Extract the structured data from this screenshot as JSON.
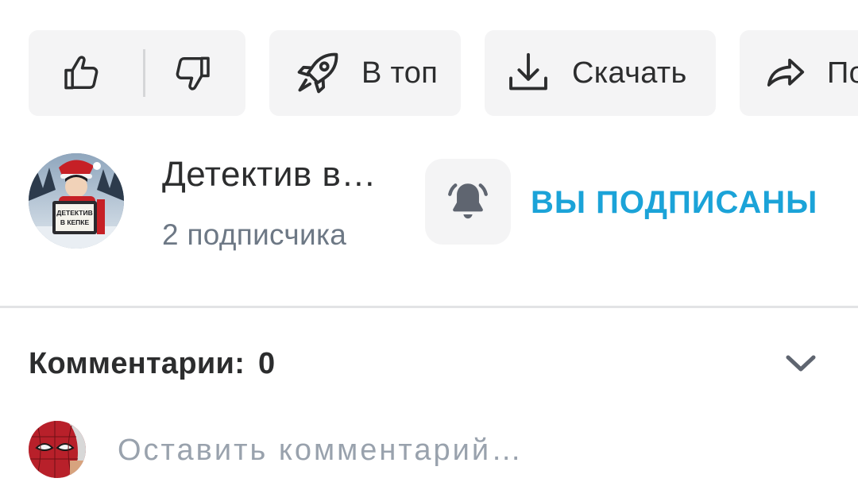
{
  "actions": {
    "top_label": "В топ",
    "download_label": "Скачать",
    "share_label": "По"
  },
  "channel": {
    "name": "Детектив в…",
    "subscribers": "2 подписчика",
    "subscribe_status": "ВЫ ПОДПИСАНЫ",
    "avatar_text_line1": "ДЕТЕКТИВ",
    "avatar_text_line2": "В КЕПКЕ"
  },
  "comments": {
    "title": "Комментарии:",
    "count": "0",
    "input_placeholder": "Оставить комментарий…"
  },
  "icons": {
    "like": "thumbs-up-icon",
    "dislike": "thumbs-down-icon",
    "top": "rocket-icon",
    "download": "download-icon",
    "share": "share-arrow-icon",
    "bell": "bell-ringing-icon",
    "chevron": "chevron-down-icon"
  },
  "colors": {
    "accent": "#1ba3d8",
    "pill_bg": "#f4f4f5",
    "text_primary": "#2c2d2e",
    "text_secondary": "#6d7885",
    "placeholder": "#99a2ad",
    "icon_gray": "#5f6570"
  }
}
